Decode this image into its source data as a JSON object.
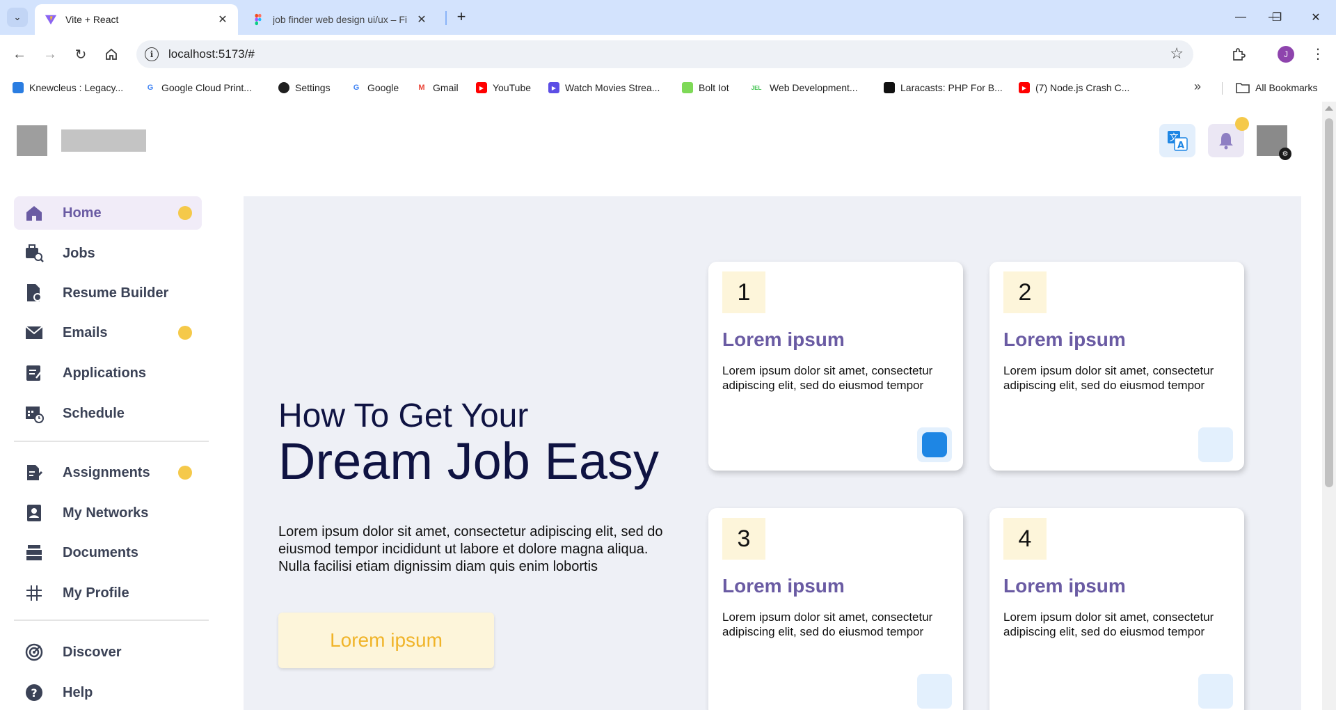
{
  "browser": {
    "tabs": [
      {
        "title": "Vite + React",
        "active": true
      },
      {
        "title": "job finder web design ui/ux – Fi",
        "active": false
      }
    ],
    "url": "localhost:5173/#",
    "profile_initial": "J",
    "bookmarks": [
      {
        "label": "Knewcleus : Legacy...",
        "color": "#2a7de1"
      },
      {
        "label": "Google Cloud Print...",
        "color": "#4285f4",
        "glyph": "G"
      },
      {
        "label": "Settings",
        "color": "#1f1f1f"
      },
      {
        "label": "Google",
        "color": "#4285f4",
        "glyph": "G"
      },
      {
        "label": "Gmail",
        "color": "#ea4335",
        "glyph": "M"
      },
      {
        "label": "YouTube",
        "color": "#ff0000",
        "glyph": "▶"
      },
      {
        "label": "Watch Movies Strea...",
        "color": "#5c4ee5",
        "glyph": "▶"
      },
      {
        "label": "Bolt Iot",
        "color": "#7ed957"
      },
      {
        "label": "Web Development...",
        "color": "#3bc14a",
        "glyph": "JEL"
      },
      {
        "label": "Laracasts: PHP For B...",
        "color": "#111111"
      },
      {
        "label": "(7) Node.js Crash C...",
        "color": "#ff0000",
        "glyph": "▶"
      }
    ],
    "all_bookmarks": "All Bookmarks"
  },
  "sidebar": {
    "items": [
      {
        "label": "Home",
        "icon": "home-icon",
        "dot": true,
        "active": true
      },
      {
        "label": "Jobs",
        "icon": "jobs-search-icon",
        "dot": false
      },
      {
        "label": "Resume Builder",
        "icon": "resume-icon",
        "dot": false
      },
      {
        "label": "Emails",
        "icon": "mail-icon",
        "dot": true
      },
      {
        "label": "Applications",
        "icon": "application-icon",
        "dot": false
      },
      {
        "label": "Schedule",
        "icon": "calendar-clock-icon",
        "dot": false
      },
      {
        "label": "Assignments",
        "icon": "assignment-icon",
        "dot": true
      },
      {
        "label": "My Networks",
        "icon": "contact-icon",
        "dot": false
      },
      {
        "label": "Documents",
        "icon": "documents-icon",
        "dot": false
      },
      {
        "label": "My Profile",
        "icon": "hashtag-icon",
        "dot": false
      },
      {
        "label": "Discover",
        "icon": "target-icon",
        "dot": false
      },
      {
        "label": "Help",
        "icon": "help-icon",
        "dot": false
      }
    ]
  },
  "hero": {
    "line1": "How To Get Your",
    "line2": "Dream Job Easy",
    "description": "Lorem ipsum dolor sit amet, consectetur adipiscing elit, sed do eiusmod tempor incididunt ut labore et dolore magna aliqua. Nulla facilisi etiam dignissim diam quis enim lobortis",
    "cta_label": "Lorem ipsum"
  },
  "cards": [
    {
      "number": "1",
      "title": "Lorem ipsum",
      "text": "Lorem ipsum dolor sit amet, consectetur adipiscing elit, sed do eiusmod tempor"
    },
    {
      "number": "2",
      "title": "Lorem ipsum",
      "text": "Lorem ipsum dolor sit amet, consectetur adipiscing elit, sed do eiusmod tempor"
    },
    {
      "number": "3",
      "title": "Lorem ipsum",
      "text": "Lorem ipsum dolor sit amet, consectetur adipiscing elit, sed do eiusmod tempor"
    },
    {
      "number": "4",
      "title": "Lorem ipsum",
      "text": "Lorem ipsum dolor sit amet, consectetur adipiscing elit, sed do eiusmod tempor"
    }
  ],
  "colors": {
    "accent_purple": "#6a5ba3",
    "accent_yellow": "#f5c94a",
    "accent_blue": "#1e86e4",
    "panel_bg": "#eef0f6"
  }
}
